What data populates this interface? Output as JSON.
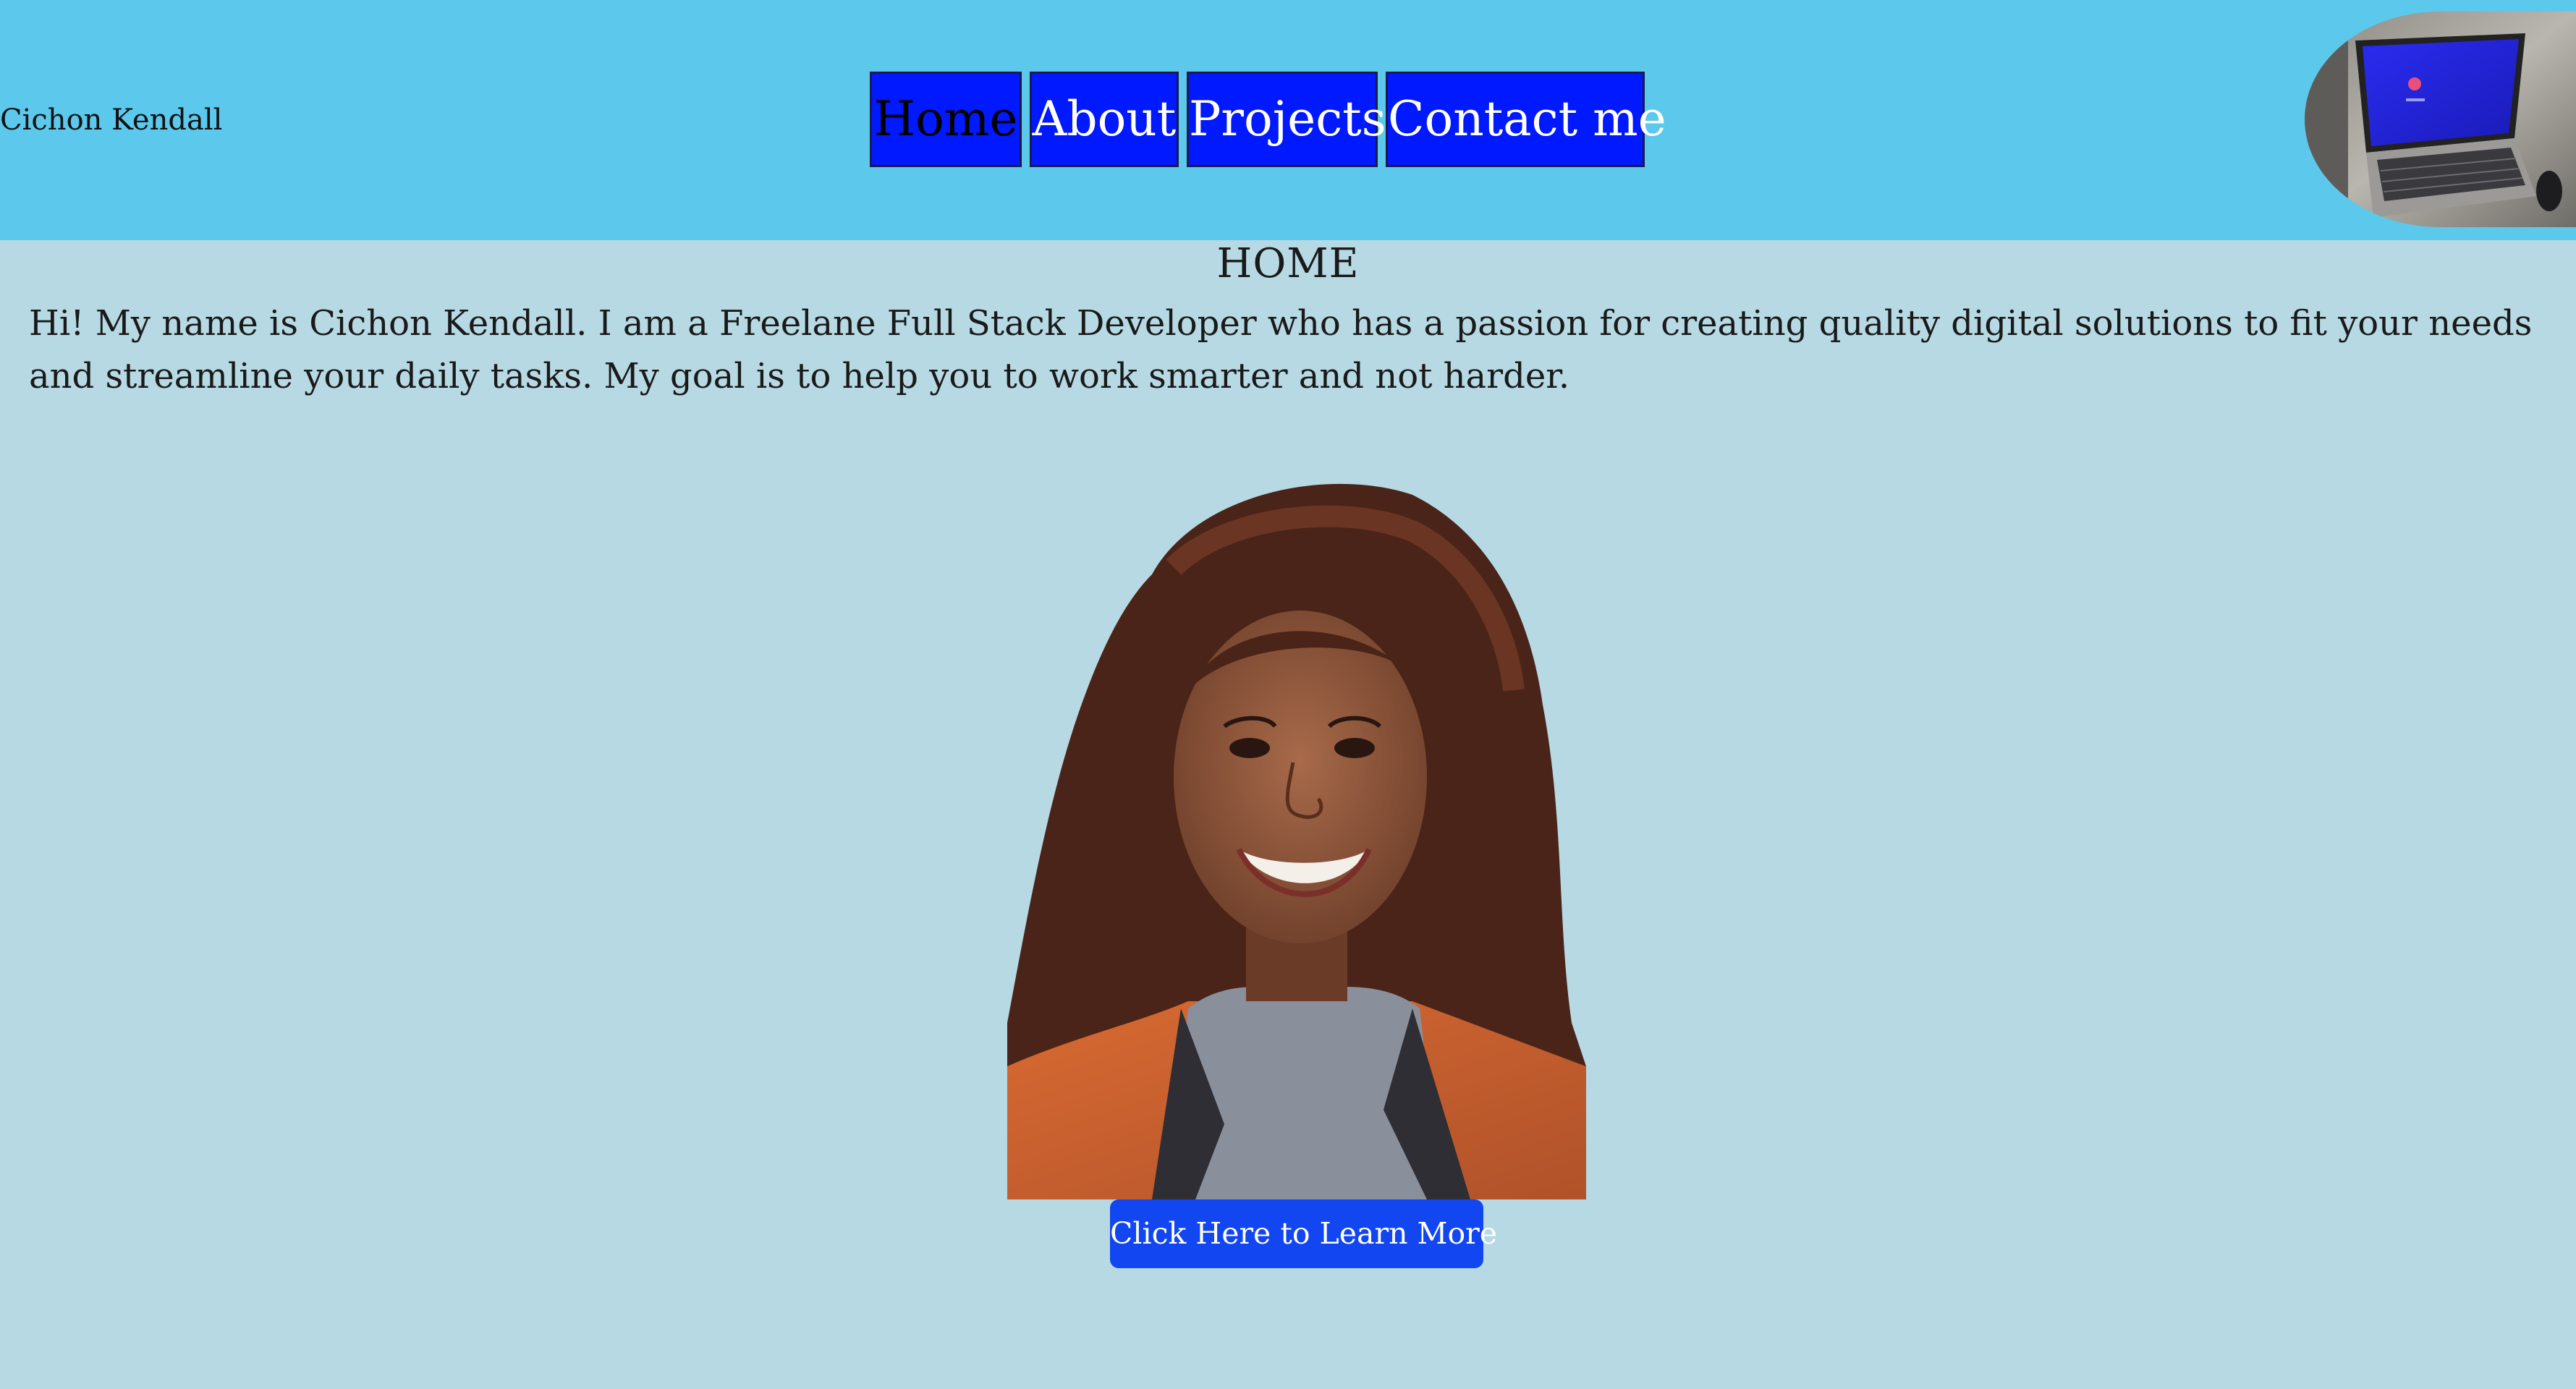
{
  "header": {
    "brand_name": "Cichon Kendall",
    "nav": {
      "home": "Home",
      "about": "About",
      "projects": "Projects",
      "contact": "Contact me"
    },
    "logo_icon": "laptop-photo-icon"
  },
  "main": {
    "section_title": "HOME",
    "intro_text": "Hi! My name is Cichon Kendall. I am a Freelane Full Stack Developer who has a passion for creating quality digital solutions to fit your needs and streamline your daily tasks. My goal is to help you to work smarter and not harder.",
    "portrait_icon": "portrait-photo",
    "cta_label": "Click Here to Learn More"
  },
  "colors": {
    "header_bg": "#5bc8ec",
    "page_bg": "#b6d9e4",
    "nav_bg": "#0019ff",
    "cta_bg": "#1146f0"
  }
}
